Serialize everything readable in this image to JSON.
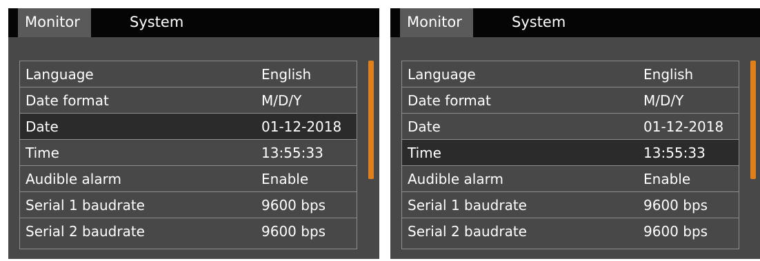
{
  "accent_color": "#e0801c",
  "panels": [
    {
      "tabs": [
        {
          "label": "Monitor",
          "active": true
        },
        {
          "label": "System",
          "active": false
        }
      ],
      "selected_row": 2,
      "rows": [
        {
          "label": "Language",
          "value": "English"
        },
        {
          "label": "Date format",
          "value": "M/D/Y"
        },
        {
          "label": "Date",
          "value": "01-12-2018"
        },
        {
          "label": "Time",
          "value": "13:55:33"
        },
        {
          "label": "Audible alarm",
          "value": "Enable"
        },
        {
          "label": "Serial 1 baudrate",
          "value": "9600 bps"
        },
        {
          "label": "Serial 2 baudrate",
          "value": "9600 bps"
        }
      ]
    },
    {
      "tabs": [
        {
          "label": "Monitor",
          "active": true
        },
        {
          "label": "System",
          "active": false
        }
      ],
      "selected_row": 3,
      "rows": [
        {
          "label": "Language",
          "value": "English"
        },
        {
          "label": "Date format",
          "value": "M/D/Y"
        },
        {
          "label": "Date",
          "value": "01-12-2018"
        },
        {
          "label": "Time",
          "value": "13:55:33"
        },
        {
          "label": "Audible alarm",
          "value": "Enable"
        },
        {
          "label": "Serial 1 baudrate",
          "value": "9600 bps"
        },
        {
          "label": "Serial 2 baudrate",
          "value": "9600 bps"
        }
      ]
    }
  ]
}
